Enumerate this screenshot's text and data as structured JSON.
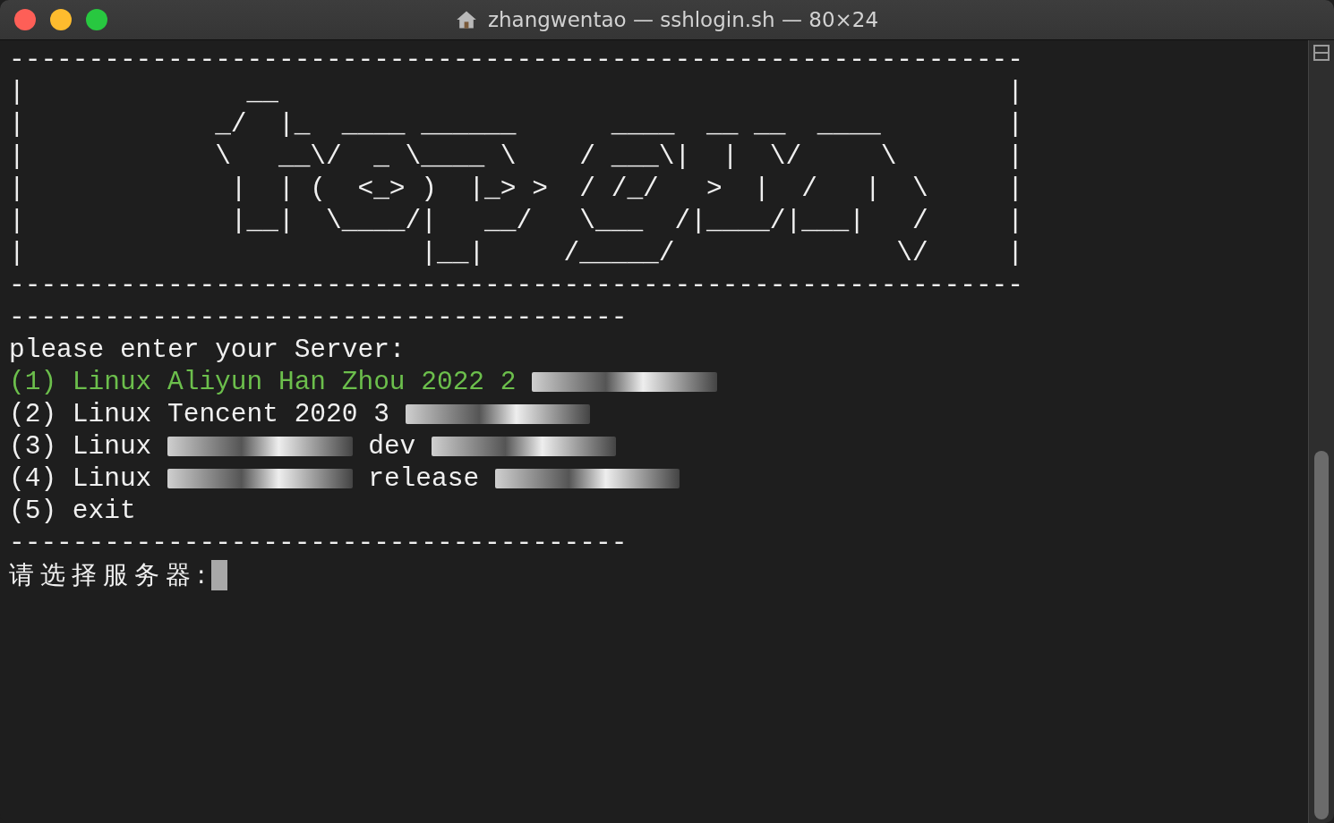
{
  "window": {
    "title": "zhangwentao — sshlogin.sh — 80×24"
  },
  "terminal": {
    "banner_lines": [
      "----------------------------------------------------------------",
      "|              __                                              |",
      "|            _/  |_  ____ ______      ____  __ __  ____        |",
      "|            \\   __\\/  _ \\____ \\    / ___\\|  |  \\/     \\       |",
      "|             |  | (  <_> )  |_> >  / /_/   >  |  /   |  \\     |",
      "|             |__|  \\____/|   __/   \\___  /|____/|___|   /     |",
      "|                         |__|     /_____/              \\/     |",
      "----------------------------------------------------------------",
      "---------------------------------------"
    ],
    "heading": "please enter your Server:",
    "options": [
      {
        "number": "(1)",
        "color": "#6cbf4c",
        "segments": [
          {
            "kind": "text",
            "text": "Linux Aliyun Han Zhou 2022 2"
          },
          {
            "kind": "redacted"
          }
        ]
      },
      {
        "number": "(2)",
        "color": "#f0f0f0",
        "segments": [
          {
            "kind": "text",
            "text": "Linux Tencent 2020 3"
          },
          {
            "kind": "redacted"
          }
        ]
      },
      {
        "number": "(3)",
        "color": "#f0f0f0",
        "segments": [
          {
            "kind": "text",
            "text": "Linux"
          },
          {
            "kind": "redacted"
          },
          {
            "kind": "text",
            "text": "dev"
          },
          {
            "kind": "redacted"
          }
        ]
      },
      {
        "number": "(4)",
        "color": "#f0f0f0",
        "segments": [
          {
            "kind": "text",
            "text": "Linux"
          },
          {
            "kind": "redacted"
          },
          {
            "kind": "text",
            "text": "release"
          },
          {
            "kind": "redacted"
          }
        ]
      },
      {
        "number": "(5)",
        "color": "#f0f0f0",
        "segments": [
          {
            "kind": "text",
            "text": "exit"
          }
        ]
      }
    ],
    "closing_separator": "---------------------------------------",
    "prompt": "请选择服务器:"
  }
}
